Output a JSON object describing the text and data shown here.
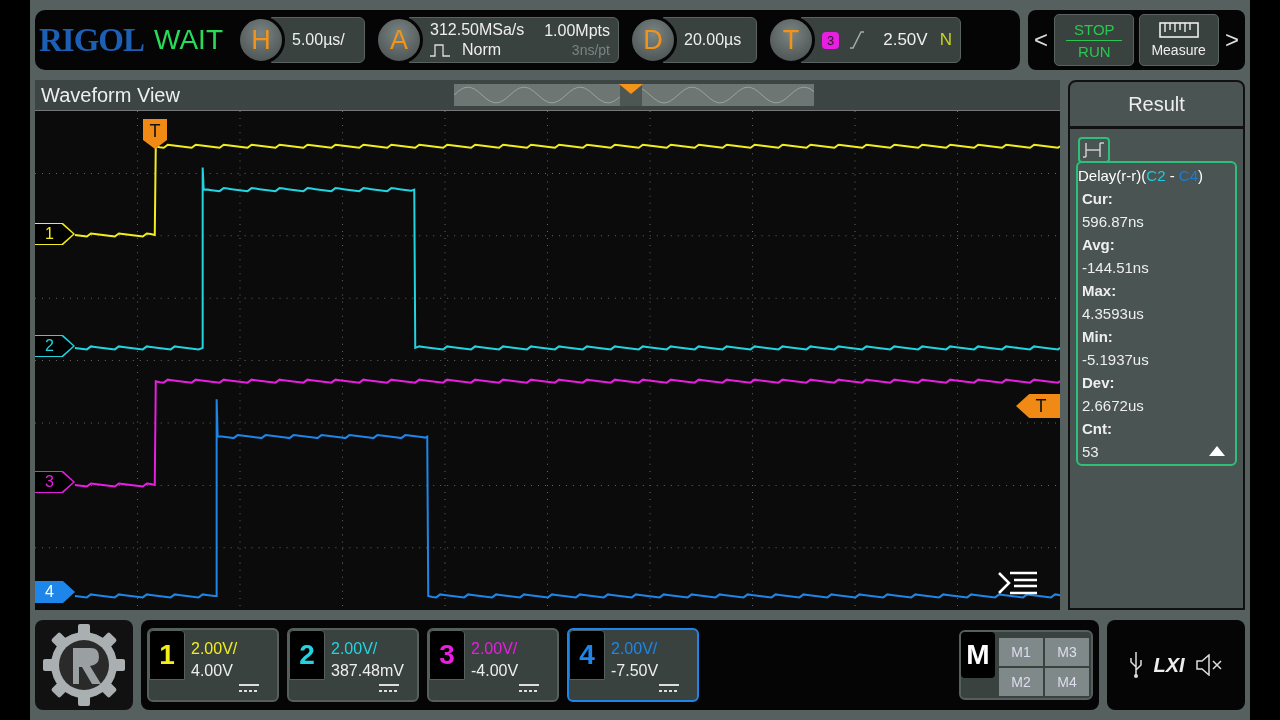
{
  "top_bar": {
    "logo": "RIGOL",
    "status": "WAIT",
    "horizontal": {
      "key": "H",
      "scale": "5.00µs/"
    },
    "acquire": {
      "key": "A",
      "sample_rate": "312.50MSa/s",
      "mode": "Norm",
      "memory_depth": "1.00Mpts",
      "resolution": "3ns/pt"
    },
    "delay": {
      "key": "D",
      "value": "20.00µs"
    },
    "trigger": {
      "key": "T",
      "source": "3",
      "level": "2.50V",
      "sweep": "N"
    },
    "run_stop": {
      "stop": "STOP",
      "run": "RUN"
    },
    "measure": {
      "label": "Measure"
    },
    "prev": "<",
    "next": ">"
  },
  "waveform_view": {
    "title": "Waveform View",
    "channel_markers": [
      {
        "label": "1"
      },
      {
        "label": "2"
      },
      {
        "label": "3"
      },
      {
        "label": "4"
      }
    ],
    "trigger_markers": [
      {
        "kind": "time",
        "label": "T"
      },
      {
        "kind": "level",
        "label": "T"
      }
    ]
  },
  "result": {
    "title": "Result",
    "measurement_parts": [
      {
        "text": "Delay(r-r)(",
        "color": "#ffffff"
      },
      {
        "text": "C2",
        "color": "#22c8dc"
      },
      {
        "text": " - ",
        "color": "#ffffff"
      },
      {
        "text": "C4",
        "color": "#1e7ad6"
      },
      {
        "text": ")",
        "color": "#ffffff"
      }
    ],
    "stats": [
      {
        "label": "Cur:",
        "value": "596.87ns"
      },
      {
        "label": "Avg:",
        "value": "-144.51ns"
      },
      {
        "label": "Max:",
        "value": "4.3593us"
      },
      {
        "label": "Min:",
        "value": "-5.1937us"
      },
      {
        "label": "Dev:",
        "value": "2.6672us"
      },
      {
        "label": "Cnt:",
        "value": "53"
      }
    ]
  },
  "channels": [
    {
      "number": "1",
      "scale": "2.00V/",
      "offset": "4.00V",
      "color": "#f2ee1e",
      "selected": false
    },
    {
      "number": "2",
      "scale": "2.00V/",
      "offset": "387.48mV",
      "color": "#22d4e0",
      "selected": false
    },
    {
      "number": "3",
      "scale": "2.00V/",
      "offset": "-4.00V",
      "color": "#e81ee0",
      "selected": false
    },
    {
      "number": "4",
      "scale": "2.00V/",
      "offset": "-7.50V",
      "color": "#1e86e8",
      "selected": true
    }
  ],
  "math": {
    "key": "M",
    "items": [
      "M1",
      "M3",
      "M2",
      "M4"
    ]
  },
  "status": {
    "lxi": "LXI"
  }
}
